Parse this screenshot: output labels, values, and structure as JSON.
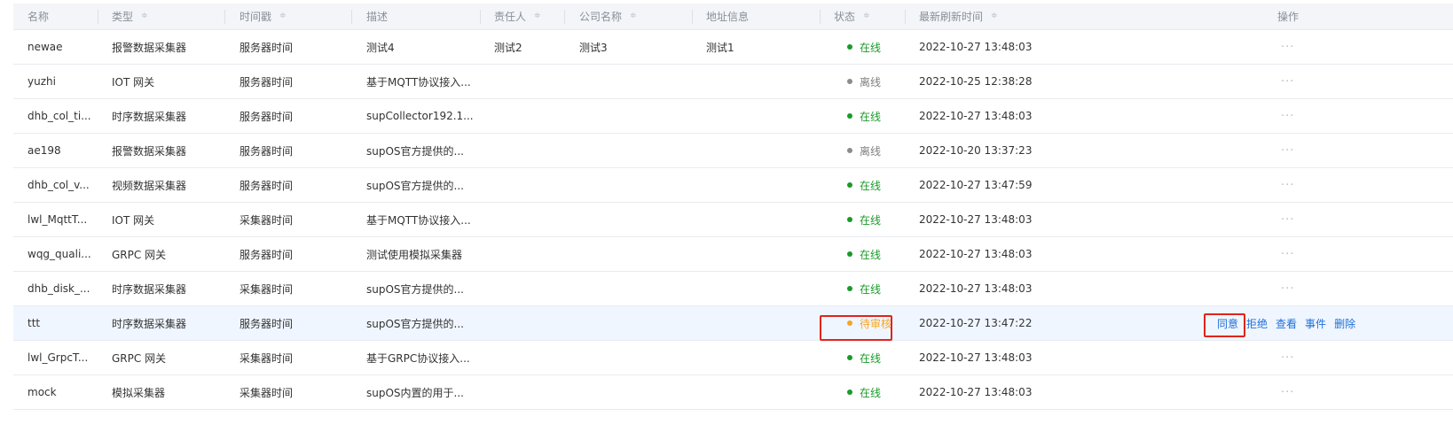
{
  "columns": {
    "name": "名称",
    "type": "类型",
    "timestamp": "时间戳",
    "desc": "描述",
    "owner": "责任人",
    "company": "公司名称",
    "address": "地址信息",
    "status": "状态",
    "refresh": "最新刷新时间",
    "actions": "操作"
  },
  "sort_glyph": "≑",
  "more_glyph": "···",
  "colors": {
    "online": "#1a9a28",
    "offline": "#8c8c8c",
    "pending": "#f5a623",
    "link": "#1d6fd9",
    "highlight_box": "#e0241e"
  },
  "rows": [
    {
      "name": "newae",
      "type": "报警数据采集器",
      "timestamp": "服务器时间",
      "desc": "测试4",
      "owner": "测试2",
      "company": "测试3",
      "address": "测试1",
      "status": "在线",
      "status_kind": "online",
      "refresh": "2022-10-27 13:48:03"
    },
    {
      "name": "yuzhi",
      "type": "IOT 网关",
      "timestamp": "服务器时间",
      "desc": "基于MQTT协议接入...",
      "owner": "",
      "company": "",
      "address": "",
      "status": "离线",
      "status_kind": "offline",
      "refresh": "2022-10-25 12:38:28"
    },
    {
      "name": "dhb_col_ti...",
      "type": "时序数据采集器",
      "timestamp": "服务器时间",
      "desc": "supCollector192.1...",
      "owner": "",
      "company": "",
      "address": "",
      "status": "在线",
      "status_kind": "online",
      "refresh": "2022-10-27 13:48:03"
    },
    {
      "name": "ae198",
      "type": "报警数据采集器",
      "timestamp": "服务器时间",
      "desc": "supOS官方提供的...",
      "owner": "",
      "company": "",
      "address": "",
      "status": "离线",
      "status_kind": "offline",
      "refresh": "2022-10-20 13:37:23"
    },
    {
      "name": "dhb_col_v...",
      "type": "视频数据采集器",
      "timestamp": "服务器时间",
      "desc": "supOS官方提供的...",
      "owner": "",
      "company": "",
      "address": "",
      "status": "在线",
      "status_kind": "online",
      "refresh": "2022-10-27 13:47:59"
    },
    {
      "name": "lwl_MqttT...",
      "type": "IOT 网关",
      "timestamp": "采集器时间",
      "desc": "基于MQTT协议接入...",
      "owner": "",
      "company": "",
      "address": "",
      "status": "在线",
      "status_kind": "online",
      "refresh": "2022-10-27 13:48:03"
    },
    {
      "name": "wqg_quali...",
      "type": "GRPC 网关",
      "timestamp": "服务器时间",
      "desc": "测试使用模拟采集器",
      "owner": "",
      "company": "",
      "address": "",
      "status": "在线",
      "status_kind": "online",
      "refresh": "2022-10-27 13:48:03"
    },
    {
      "name": "dhb_disk_...",
      "type": "时序数据采集器",
      "timestamp": "采集器时间",
      "desc": "supOS官方提供的...",
      "owner": "",
      "company": "",
      "address": "",
      "status": "在线",
      "status_kind": "online",
      "refresh": "2022-10-27 13:48:03"
    },
    {
      "name": "ttt",
      "type": "时序数据采集器",
      "timestamp": "服务器时间",
      "desc": "supOS官方提供的...",
      "owner": "",
      "company": "",
      "address": "",
      "status": "待审核",
      "status_kind": "pending",
      "refresh": "2022-10-27 13:47:22",
      "actions": [
        "同意",
        "拒绝",
        "查看",
        "事件",
        "删除"
      ]
    },
    {
      "name": "lwl_GrpcT...",
      "type": "GRPC 网关",
      "timestamp": "采集器时间",
      "desc": "基于GRPC协议接入...",
      "owner": "",
      "company": "",
      "address": "",
      "status": "在线",
      "status_kind": "online",
      "refresh": "2022-10-27 13:48:03"
    },
    {
      "name": "mock",
      "type": "模拟采集器",
      "timestamp": "采集器时间",
      "desc": "supOS内置的用于...",
      "owner": "",
      "company": "",
      "address": "",
      "status": "在线",
      "status_kind": "online",
      "refresh": "2022-10-27 13:48:03"
    }
  ]
}
